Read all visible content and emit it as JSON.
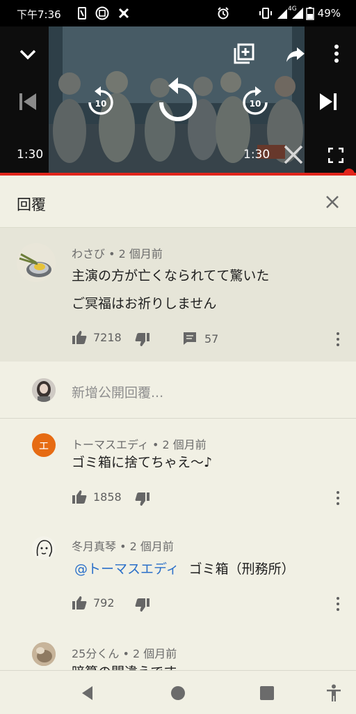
{
  "status_bar": {
    "time": "下午7:36",
    "battery": "49%",
    "network": "4G"
  },
  "player": {
    "current_time": "1:30",
    "duration": "1:30",
    "progress": 1.0,
    "icons": [
      "chevron-down-icon",
      "add-to-playlist-icon",
      "share-icon",
      "more-vert-icon",
      "skip-previous-icon",
      "rewind-10-icon",
      "replay-icon",
      "forward-10-icon",
      "skip-next-icon",
      "close-icon",
      "fullscreen-icon"
    ]
  },
  "replies_header": {
    "title": "回覆"
  },
  "main_comment": {
    "author": "わさび",
    "time": "2 個月前",
    "text_line1": "主演の方が亡くなられてて驚いた",
    "text_line2": "ご冥福はお祈りしません",
    "likes": "7218",
    "replies": "57"
  },
  "add_reply": {
    "placeholder": "新增公開回覆..."
  },
  "replies": [
    {
      "author": "トーマスエディ",
      "time": "2 個月前",
      "avatar_letter": "エ",
      "avatar_color": "#e66b13",
      "text": "ゴミ箱に捨てちゃえ～♪",
      "likes": "1858"
    },
    {
      "author": "冬月真琴",
      "time": "2 個月前",
      "mention": "@トーマスエディ",
      "text": "ゴミ箱（刑務所）",
      "likes": "792"
    },
    {
      "author": "25分くん",
      "time": "2 個月前",
      "text": "暗算の間違えです"
    }
  ],
  "colors": {
    "accent_red": "#e1251b",
    "link_blue": "#2a6fc9",
    "background": "#f1f0e4"
  }
}
